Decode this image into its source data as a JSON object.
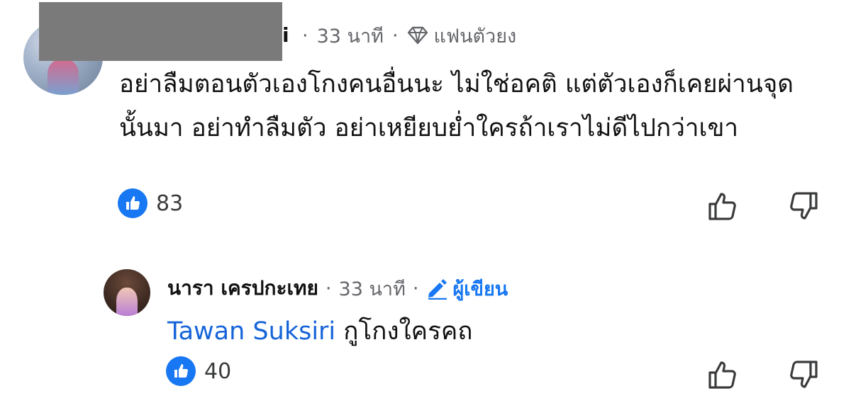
{
  "comments": [
    {
      "author_visible": "i",
      "time": "33 นาที",
      "badge": "แฟนตัวยง",
      "badge_icon": "diamond-icon",
      "text": "อย่าลืมตอนตัวเองโกงคนอื่นนะ ไม่ใช่อคติ แต่ตัวเองก็เคยผ่านจุดนั้นมา อย่าทำลืมตัว อย่าเหยียบย่ำใครถ้าเราไม่ดีไปกว่าเขา",
      "reaction_icon": "like-icon",
      "reaction_count": "83"
    },
    {
      "author": "นารา เครปกะเทย",
      "time": "33 นาที",
      "badge": "ผู้เขียน",
      "badge_icon": "pencil-icon",
      "mention": "Tawan Suksiri",
      "text": "กูโกงใครคถ",
      "reaction_icon": "like-icon",
      "reaction_count": "40"
    }
  ],
  "separator": "·",
  "colors": {
    "accent": "#1877f2",
    "mention": "#1664d9",
    "meta": "#65676b",
    "redaction": "#7a7a7a"
  }
}
